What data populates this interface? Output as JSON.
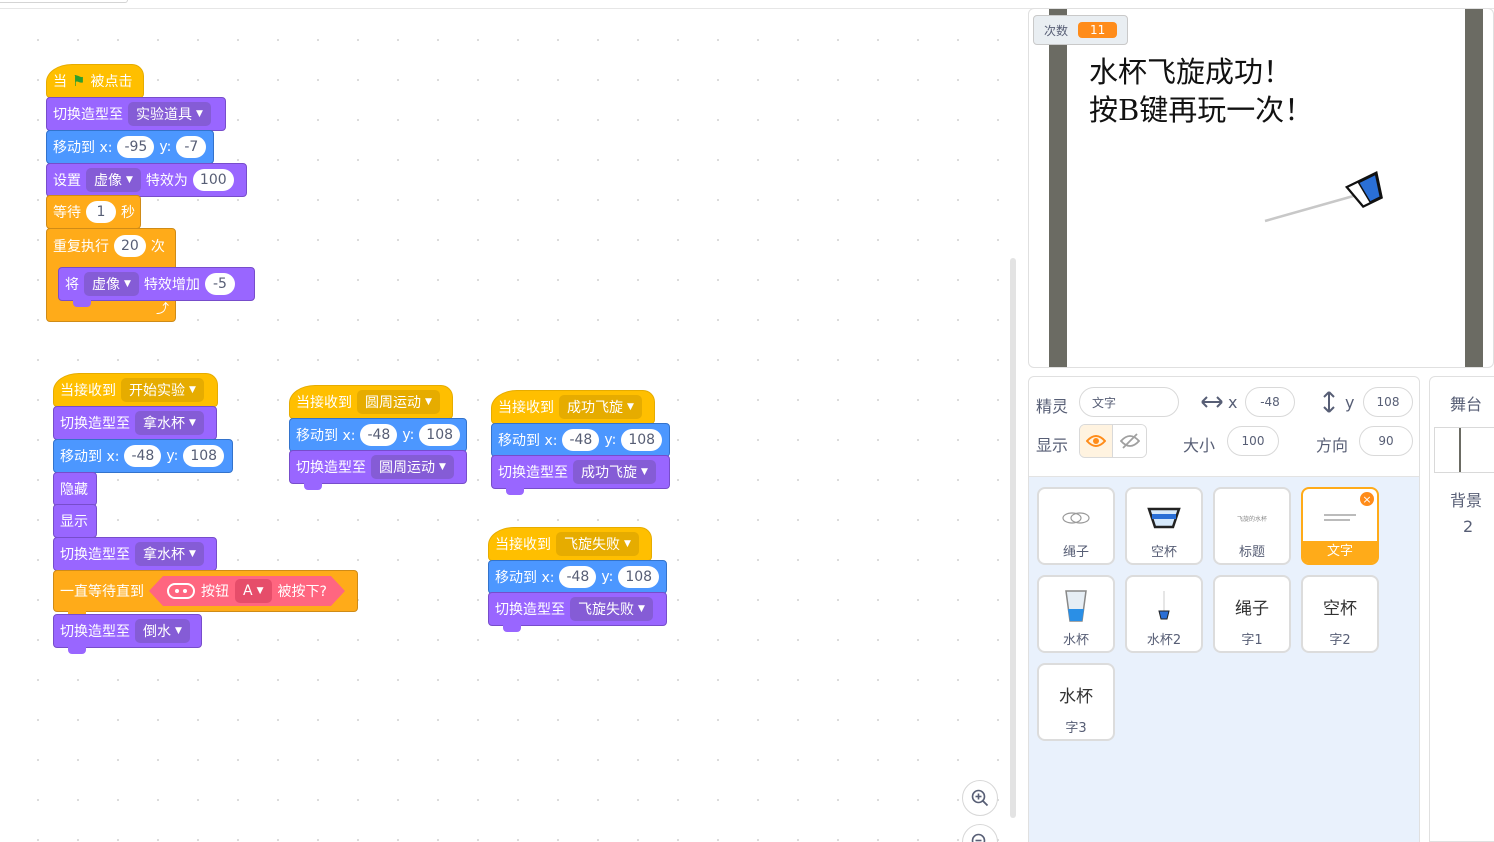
{
  "scripts": {
    "s1": {
      "hat_when": "当",
      "hat_clicked": "被点击",
      "switch_costume": "切换造型至",
      "costume1": "实验道具",
      "goto": "移动到 x:",
      "goto_x": "-95",
      "y_label": "y:",
      "goto_y": "-7",
      "set": "设置",
      "effect1": "虚像",
      "effect_is": "特效为",
      "effect_val": "100",
      "wait": "等待",
      "wait_val": "1",
      "seconds": "秒",
      "repeat": "重复执行",
      "repeat_val": "20",
      "times": "次",
      "change": "将",
      "effect2": "虚像",
      "change_by": "特效增加",
      "change_val": "-5"
    },
    "s2": {
      "when_receive": "当接收到",
      "msg": "开始实验",
      "switch_costume": "切换造型至",
      "costume1": "拿水杯",
      "goto": "移动到 x:",
      "goto_x": "-48",
      "y_label": "y:",
      "goto_y": "108",
      "hide": "隐藏",
      "show": "显示",
      "switch_costume2": "切换造型至",
      "costume2": "拿水杯",
      "wait_until": "一直等待直到",
      "button": "按钮",
      "button_key": "A",
      "pressed": "被按下?",
      "switch_costume3": "切换造型至",
      "costume3": "倒水"
    },
    "s3": {
      "when_receive": "当接收到",
      "msg": "圆周运动",
      "goto": "移动到 x:",
      "goto_x": "-48",
      "y_label": "y:",
      "goto_y": "108",
      "switch_costume": "切换造型至",
      "costume": "圆周运动"
    },
    "s4": {
      "when_receive": "当接收到",
      "msg": "成功飞旋",
      "goto": "移动到 x:",
      "goto_x": "-48",
      "y_label": "y:",
      "goto_y": "108",
      "switch_costume": "切换造型至",
      "costume": "成功飞旋"
    },
    "s5": {
      "when_receive": "当接收到",
      "msg": "飞旋失败",
      "goto": "移动到 x:",
      "goto_x": "-48",
      "y_label": "y:",
      "goto_y": "108",
      "switch_costume": "切换造型至",
      "costume": "飞旋失败"
    }
  },
  "zoom": {
    "zoom_in_icon": "zoom-in-icon",
    "zoom_out_icon": "zoom-out-icon"
  },
  "stage": {
    "counter_label": "次数",
    "counter_value": "11",
    "line1": "水杯飞旋成功！",
    "line2": "按B键再玩一次！"
  },
  "sprite_info": {
    "sprite_label": "精灵",
    "sprite_name": "文字",
    "x_label": "x",
    "x_value": "-48",
    "y_label": "y",
    "y_value": "108",
    "show_label": "显示",
    "size_label": "大小",
    "size_value": "100",
    "direction_label": "方向",
    "direction_value": "90"
  },
  "sprites": [
    {
      "name": "绳子",
      "thumb": ""
    },
    {
      "name": "空杯",
      "thumb": ""
    },
    {
      "name": "标题",
      "thumb": "飞旋的水杯"
    },
    {
      "name": "文字",
      "thumb": ""
    },
    {
      "name": "水杯",
      "thumb": ""
    },
    {
      "name": "水杯2",
      "thumb": ""
    },
    {
      "name": "字1",
      "thumb": "绳子"
    },
    {
      "name": "字2",
      "thumb": "空杯"
    },
    {
      "name": "字3",
      "thumb": "水杯"
    }
  ],
  "stage_pane": {
    "title": "舞台",
    "backdrop_label": "背景",
    "backdrop_count": "2"
  },
  "colors": {
    "events": "#ffbf00",
    "looks": "#9966ff",
    "motion": "#4c97ff",
    "control": "#ffab19",
    "sensing": "#ff6680",
    "selected": "#ffab19"
  }
}
